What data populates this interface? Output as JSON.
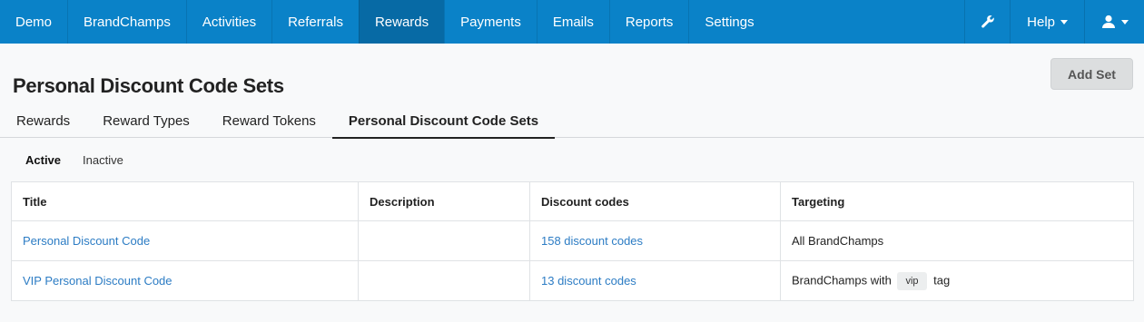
{
  "nav": {
    "items": [
      {
        "label": "Demo",
        "active": false
      },
      {
        "label": "BrandChamps",
        "active": false
      },
      {
        "label": "Activities",
        "active": false
      },
      {
        "label": "Referrals",
        "active": false
      },
      {
        "label": "Rewards",
        "active": true
      },
      {
        "label": "Payments",
        "active": false
      },
      {
        "label": "Emails",
        "active": false
      },
      {
        "label": "Reports",
        "active": false
      },
      {
        "label": "Settings",
        "active": false
      }
    ],
    "wrench_icon": "wrench-icon",
    "help_label": "Help",
    "user_icon": "user-icon"
  },
  "page": {
    "title": "Personal Discount Code Sets",
    "add_button": "Add Set"
  },
  "tabs": [
    {
      "label": "Rewards",
      "active": false
    },
    {
      "label": "Reward Types",
      "active": false
    },
    {
      "label": "Reward Tokens",
      "active": false
    },
    {
      "label": "Personal Discount Code Sets",
      "active": true
    }
  ],
  "subtabs": [
    {
      "label": "Active",
      "active": true
    },
    {
      "label": "Inactive",
      "active": false
    }
  ],
  "table": {
    "headers": [
      "Title",
      "Description",
      "Discount codes",
      "Targeting"
    ],
    "rows": [
      {
        "title": "Personal Discount Code",
        "description": "",
        "codes": "158 discount codes",
        "targeting_prefix": "All BrandChamps",
        "tag": "",
        "targeting_suffix": ""
      },
      {
        "title": "VIP Personal Discount Code",
        "description": "",
        "codes": "13 discount codes",
        "targeting_prefix": "BrandChamps with",
        "tag": "vip",
        "targeting_suffix": "tag"
      }
    ]
  },
  "colors": {
    "navbar": "#0a82c8",
    "navbar_active": "#076aa5",
    "link": "#2c7cc4"
  }
}
